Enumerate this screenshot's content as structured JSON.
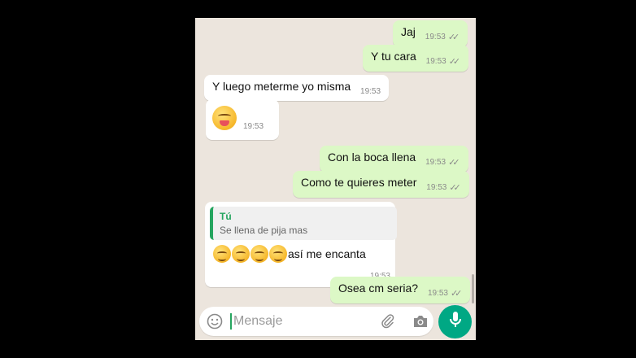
{
  "messages": [
    {
      "direction": "out",
      "text": "Jaj",
      "time": "19:53",
      "ticks": "✓✓"
    },
    {
      "direction": "out",
      "text": "Y tu cara",
      "time": "19:53",
      "ticks": "✓✓"
    },
    {
      "direction": "in",
      "text": "Y luego meterme yo misma",
      "time": "19:53"
    },
    {
      "direction": "in",
      "emoji": "drooling-face",
      "time": "19:53"
    },
    {
      "direction": "out",
      "text": "Con la boca llena",
      "time": "19:53",
      "ticks": "✓✓"
    },
    {
      "direction": "out",
      "text": "Como te quieres meter",
      "time": "19:53",
      "ticks": "✓✓"
    },
    {
      "direction": "in",
      "quote": {
        "author": "Tú",
        "text": "Se llena de pija mas"
      },
      "emoji": "relieved-face x4",
      "text": "así me encanta",
      "time": "19:53"
    },
    {
      "direction": "out",
      "text": "Osea cm seria?",
      "time": "19:53",
      "ticks": "✓✓"
    }
  ],
  "input": {
    "placeholder": "Mensaje"
  },
  "icons": {
    "emoji_button": "smiley-icon",
    "attach": "paperclip-icon",
    "camera": "camera-icon",
    "send": "microphone-icon"
  },
  "colors": {
    "outgoing_bubble": "#dcf8c6",
    "incoming_bubble": "#ffffff",
    "chat_background": "#ece5dd",
    "accent": "#00a884"
  }
}
